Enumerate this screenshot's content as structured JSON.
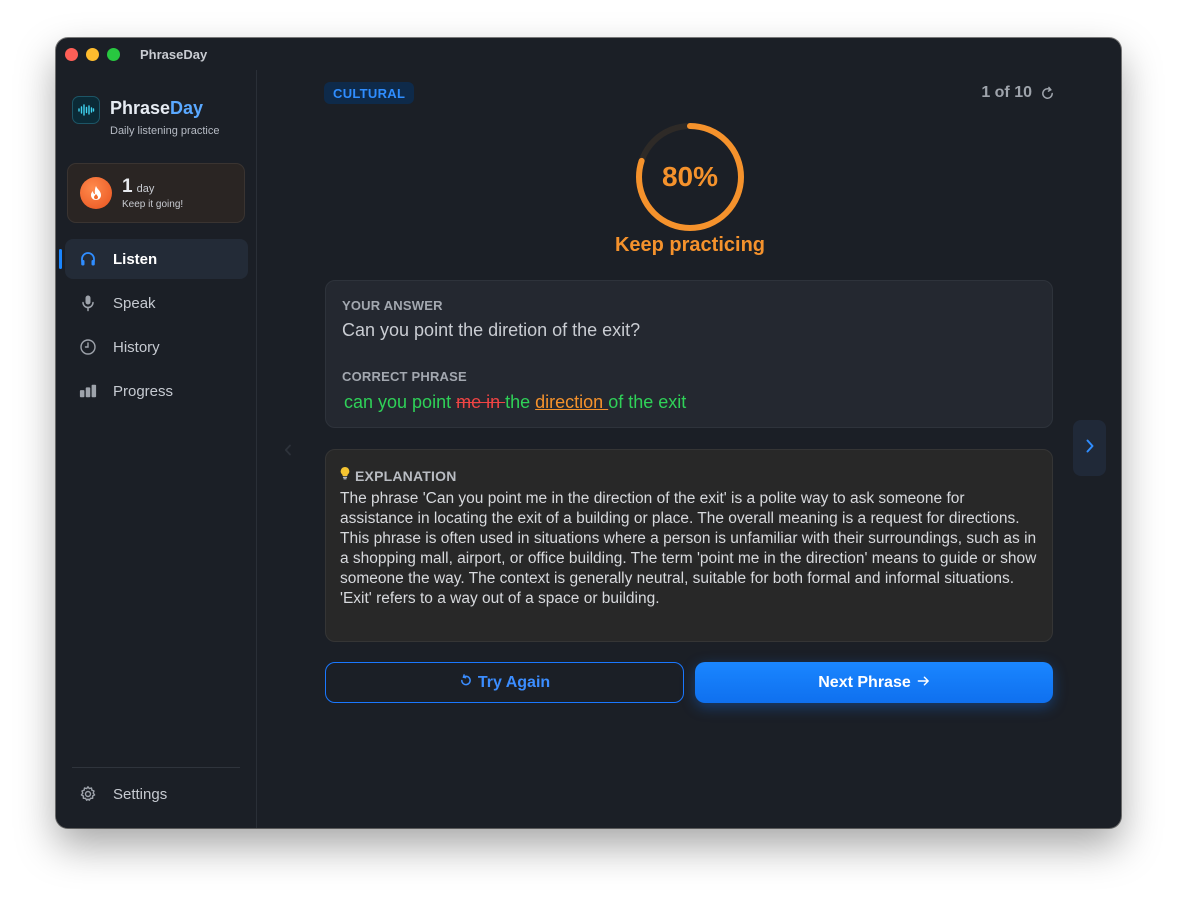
{
  "window": {
    "title": "PhraseDay"
  },
  "sidebar": {
    "brand_name_prefix": "Phrase",
    "brand_name_suffix": "Day",
    "brand_subtitle": "Daily listening practice",
    "streak": {
      "count": "1",
      "unit": "day",
      "note": "Keep it going!"
    },
    "items": [
      {
        "label": "Listen",
        "icon": "headphones-icon",
        "active": true
      },
      {
        "label": "Speak",
        "icon": "microphone-icon",
        "active": false
      },
      {
        "label": "History",
        "icon": "clock-icon",
        "active": false
      },
      {
        "label": "Progress",
        "icon": "bar-chart-icon",
        "active": false
      }
    ],
    "settings_label": "Settings"
  },
  "main": {
    "category_tag": "CULTURAL",
    "counter": "1 of 10",
    "score": {
      "value": "80%",
      "fraction": 0.8,
      "label": "Keep practicing"
    },
    "answer": {
      "your_answer_label": "YOUR ANSWER",
      "your_answer": "Can you point the diretion of the exit?",
      "correct_label": "CORRECT PHRASE",
      "segments": {
        "s1": "can you point ",
        "s2": "me in ",
        "s3": "the ",
        "s4": "direction ",
        "s5": "of the exit"
      }
    },
    "explanation": {
      "label": "EXPLANATION",
      "text": "The phrase 'Can you point me in the direction of the exit' is a polite way to ask someone for assistance in locating the exit of a building or place. The overall meaning is a request for directions. This phrase is often used in situations where a person is unfamiliar with their surroundings, such as in a shopping mall, airport, or office building. The term 'point me in the direction' means to guide or show someone the way. The context is generally neutral, suitable for both formal and informal situations. 'Exit' refers to a way out of a space or building."
    },
    "buttons": {
      "try_again": "Try Again",
      "next_phrase": "Next Phrase"
    }
  },
  "colors": {
    "accent": "#1a86ff",
    "score_orange": "#f5922c",
    "correct_green": "#2fd158",
    "wrong_red": "#ef4444"
  }
}
